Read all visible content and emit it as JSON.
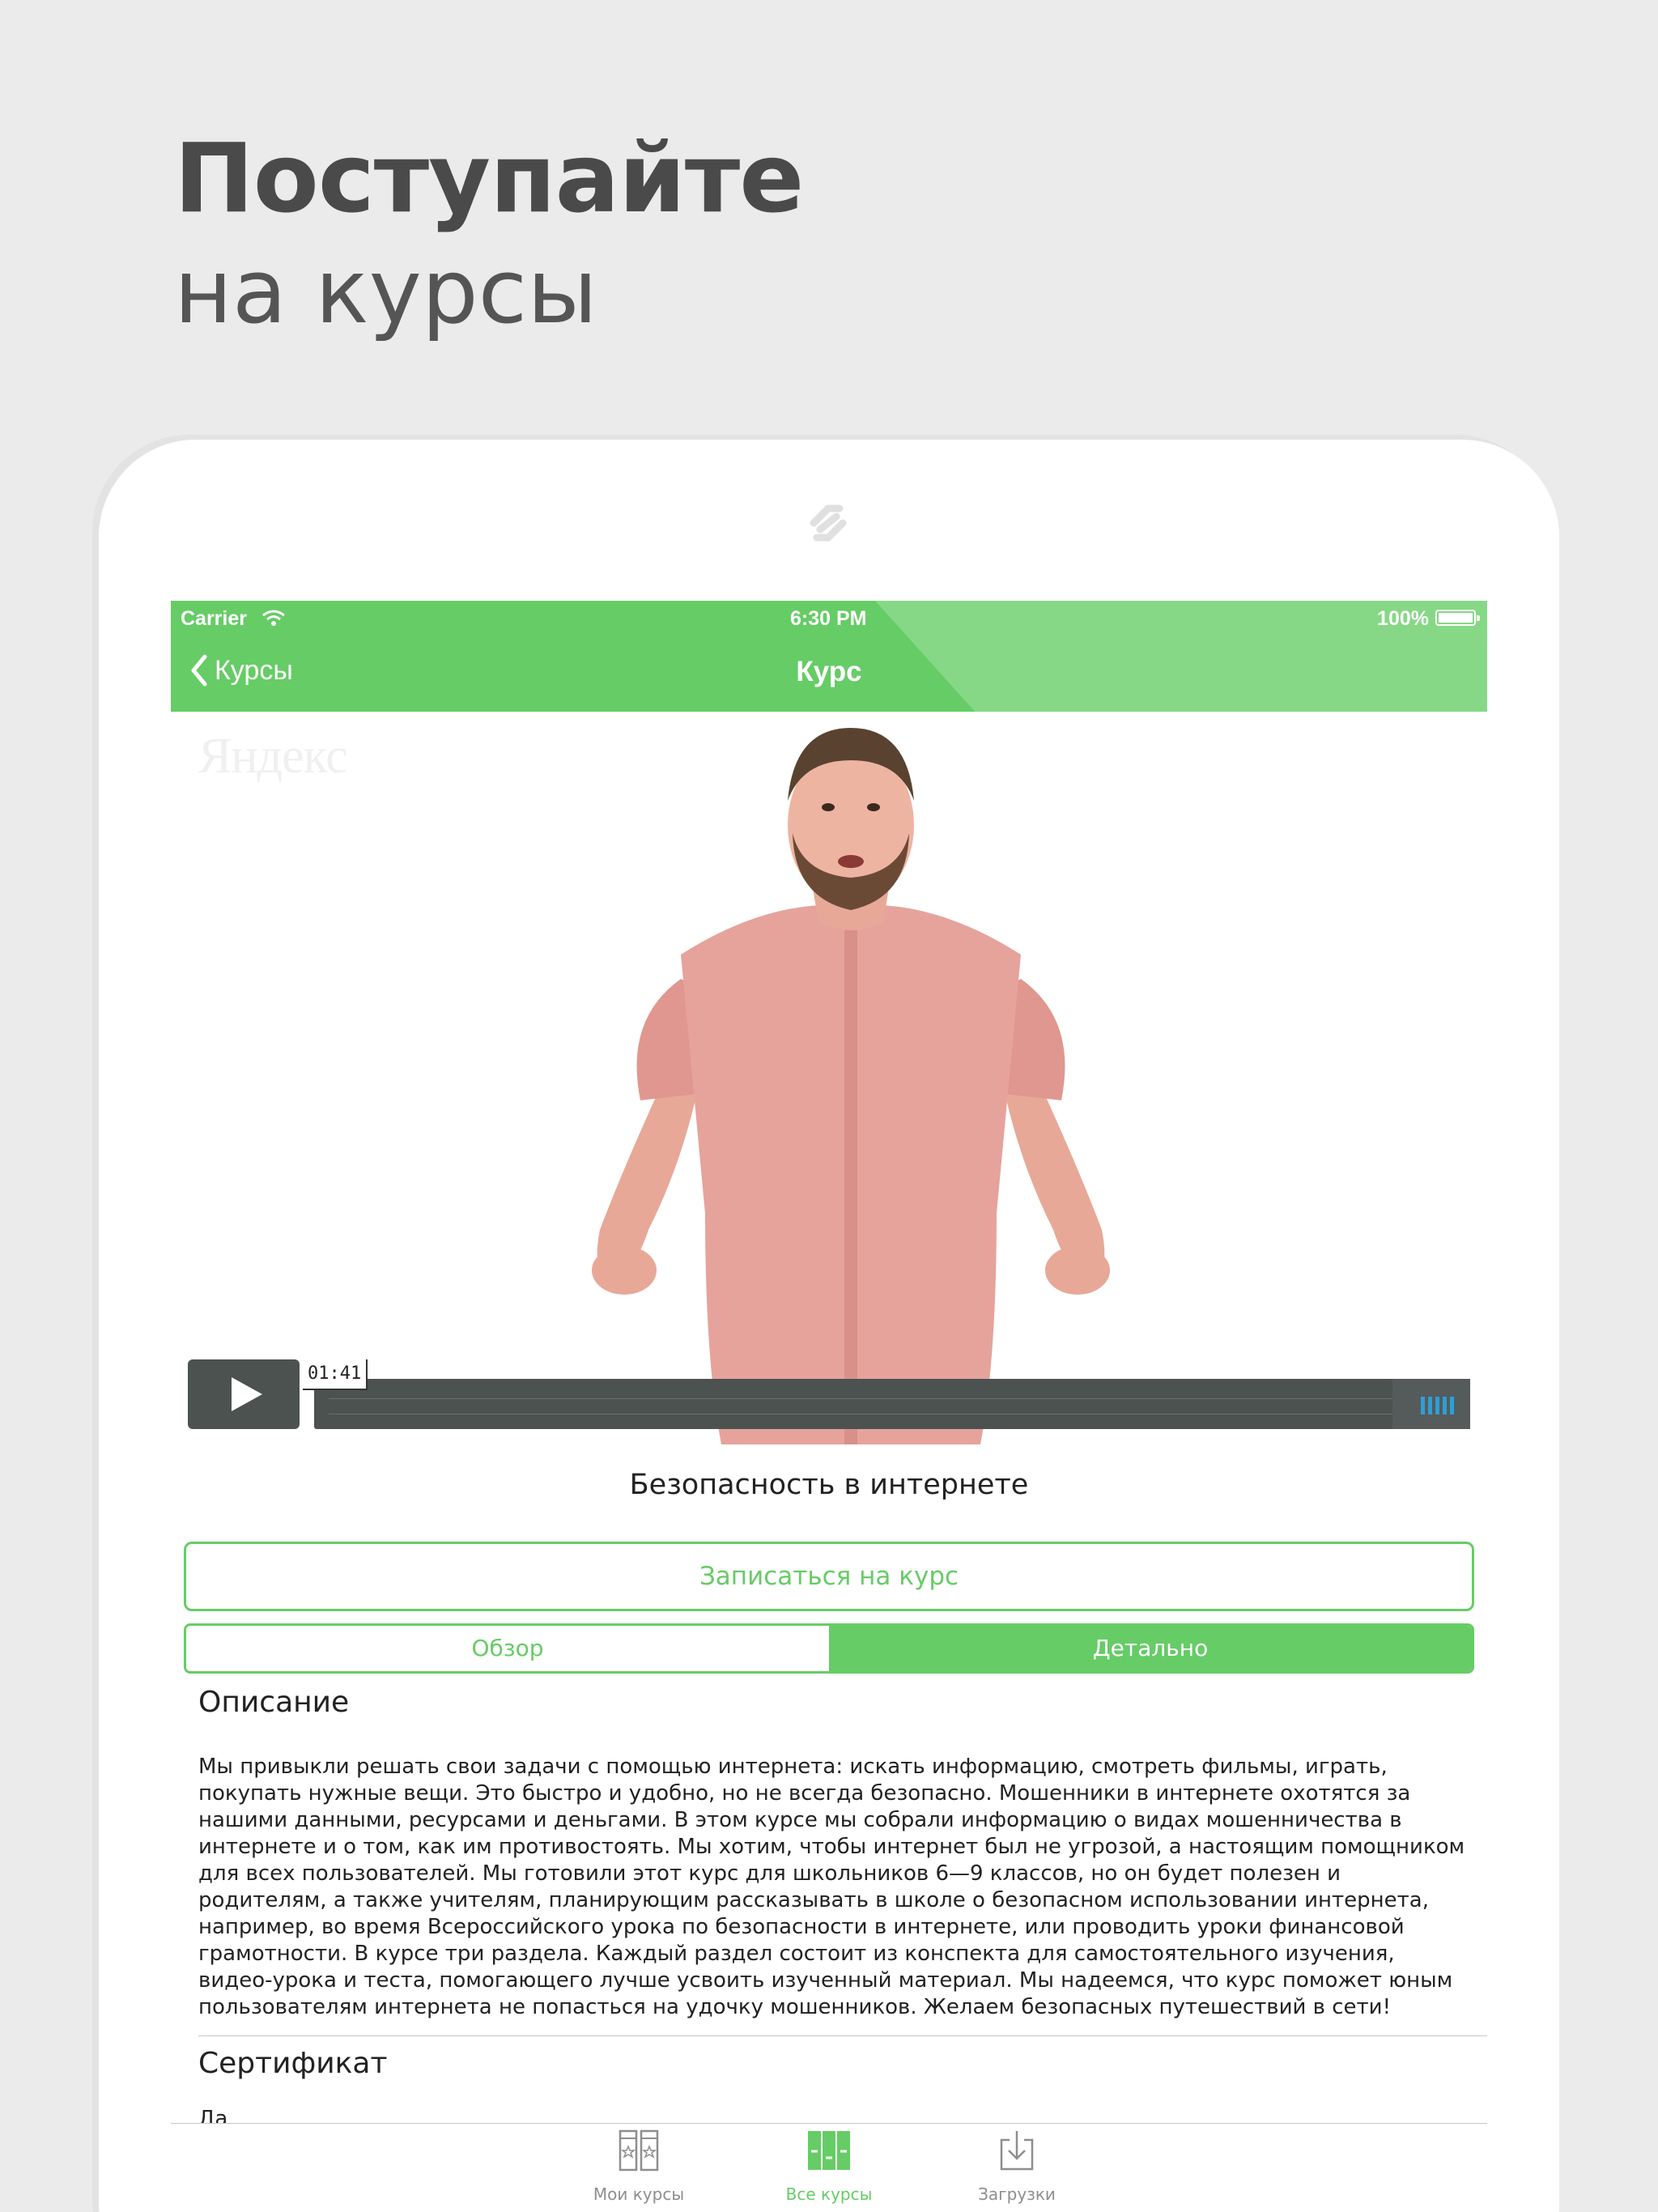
{
  "headline": {
    "line1": "Поступайте",
    "line2": "на курсы"
  },
  "status_bar": {
    "carrier": "Carrier",
    "time": "6:30 PM",
    "battery": "100%"
  },
  "nav": {
    "back_label": "Курсы",
    "title": "Курс"
  },
  "video": {
    "watermark": "Яндекс",
    "current_time": "01:41",
    "progress_fraction": 0.02
  },
  "course": {
    "title": "Безопасность в интернете",
    "enroll_label": "Записаться на курс"
  },
  "segments": [
    {
      "label": "Обзор",
      "active": false
    },
    {
      "label": "Детально",
      "active": true
    }
  ],
  "description": {
    "heading": "Описание",
    "text": "Мы привыкли решать свои задачи с помощью интернета: искать информацию, смотреть фильмы, играть, покупать нужные вещи. Это быстро и удобно, но не всегда безопасно. Мошенники в интернете охотятся за нашими данными, ресурсами и деньгами. В этом курсе мы собрали информацию о видах мошенничества в интернете и о том, как им противостоять. Мы хотим, чтобы интернет был не угрозой, а настоящим помощником для всех пользователей. Мы готовили этот курс для школьников 6—9 классов, но он будет полезен и родителям, а также учителям, планирующим рассказывать в школе о безопасном использовании интернета, например, во время Всероссийского урока по безопасности в интернете, или проводить уроки финансовой грамотности. В курсе три раздела. Каждый раздел состоит из конспекта для самостоятельного изучения, видео-урока и теста, помогающего лучше усвоить изученный материал. Мы надеемся, что курс поможет юным пользователям интернета не попасться на удочку мошенников. Желаем безопасных путешествий в сети!"
  },
  "certificate": {
    "heading": "Сертификат",
    "value": "Да"
  },
  "tabbar": [
    {
      "label": "Мои курсы",
      "icon": "my-courses-icon",
      "active": false
    },
    {
      "label": "Все курсы",
      "icon": "all-courses-icon",
      "active": true
    },
    {
      "label": "Загрузки",
      "icon": "downloads-icon",
      "active": false
    }
  ],
  "colors": {
    "accent": "#66cc66",
    "accent_light": "#86d886",
    "player_bg": "#4b5250",
    "volume": "#2b9fd9"
  }
}
